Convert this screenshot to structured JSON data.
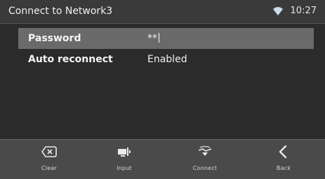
{
  "header": {
    "title": "Connect to Network3",
    "time": "10:27",
    "wifi_icon": "wifi-icon"
  },
  "form": {
    "rows": [
      {
        "label": "Password",
        "value": "**",
        "selected": true
      },
      {
        "label": "Auto reconnect",
        "value": "Enabled",
        "selected": false
      }
    ]
  },
  "bottom_bar": {
    "buttons": [
      {
        "label": "Clear",
        "icon": "backspace-icon"
      },
      {
        "label": "Input",
        "icon": "keyboard-input-icon"
      },
      {
        "label": "Connect",
        "icon": "connect-icon"
      },
      {
        "label": "Back",
        "icon": "chevron-left-icon"
      }
    ]
  },
  "colors": {
    "background": "#2b2b2b",
    "topbar": "#3a3a3a",
    "selected_row": "#6a6a6a",
    "bottombar": "#4a4a4a",
    "text": "#f0f0f0"
  }
}
